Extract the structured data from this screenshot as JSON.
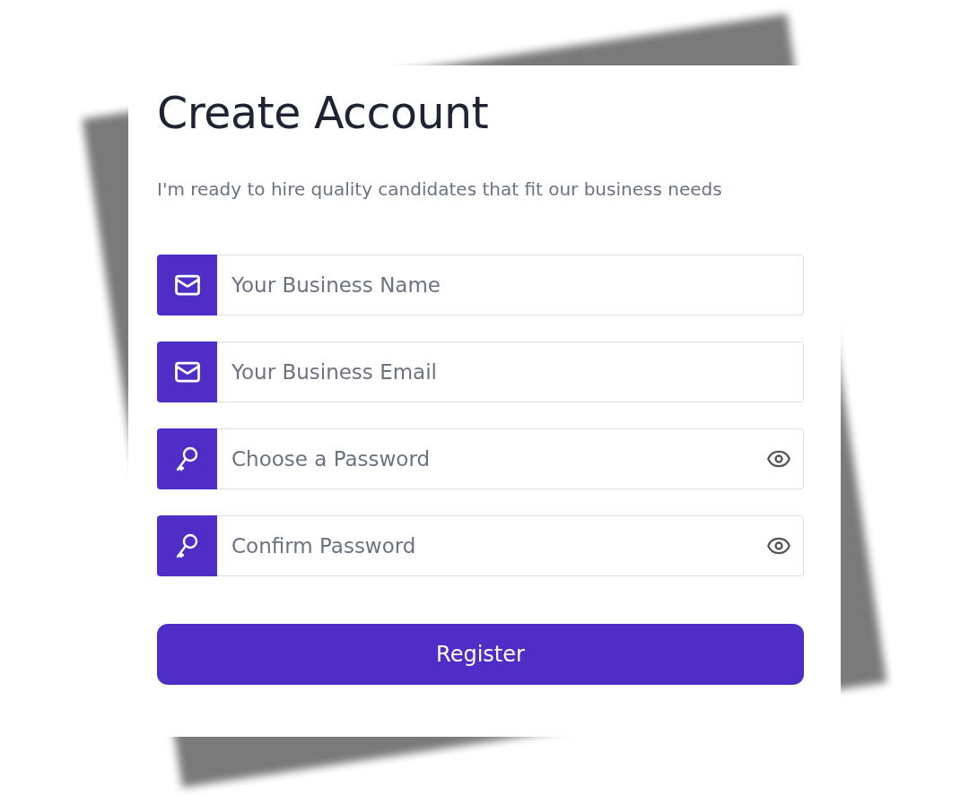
{
  "title": "Create Account",
  "subtitle": "I'm ready to hire quality candidates that fit our business needs",
  "fields": [
    {
      "kind": "plain",
      "placeholder": "Your Business Name"
    },
    {
      "kind": "plain",
      "placeholder": "Your Business Email"
    },
    {
      "kind": "secret",
      "placeholder": "Choose a Password"
    },
    {
      "kind": "secret",
      "placeholder": "Confirm Password"
    }
  ],
  "button": "Register"
}
